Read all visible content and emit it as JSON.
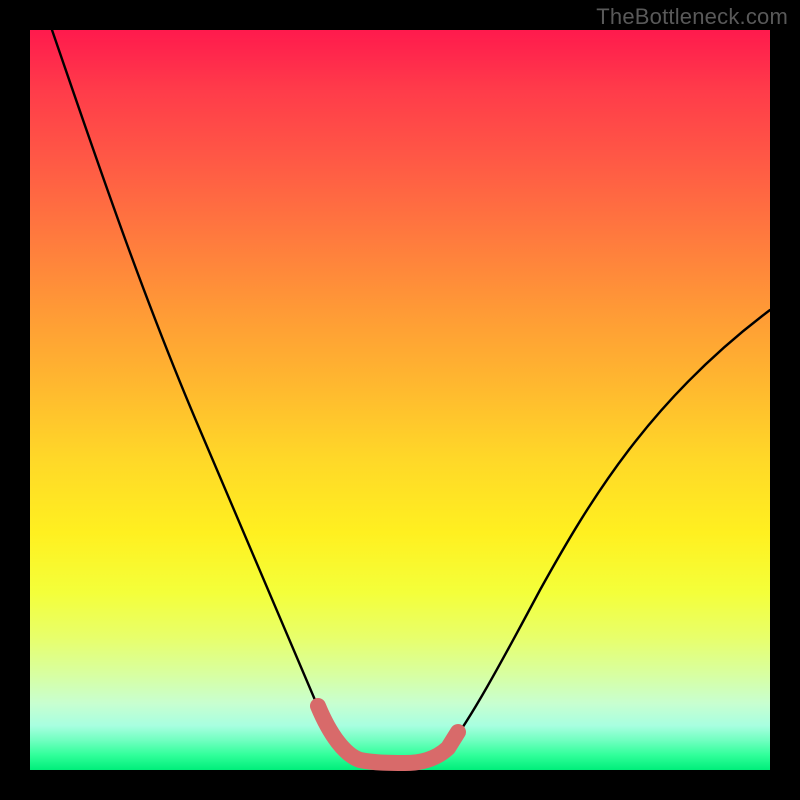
{
  "watermark": "TheBottleneck.com",
  "chart_data": {
    "type": "line",
    "title": "",
    "xlabel": "",
    "ylabel": "",
    "xlim": [
      0,
      100
    ],
    "ylim": [
      0,
      100
    ],
    "grid": false,
    "legend": false,
    "series": [
      {
        "name": "bottleneck-curve",
        "color": "#000000",
        "x": [
          3,
          10,
          18,
          25,
          30,
          35,
          38,
          40,
          42,
          44,
          46,
          50,
          54,
          56,
          58,
          62,
          68,
          75,
          82,
          90,
          100
        ],
        "y": [
          100,
          82,
          62,
          44,
          32,
          20,
          12,
          8,
          5,
          3,
          2,
          2,
          2,
          3,
          5,
          10,
          20,
          32,
          42,
          52,
          62
        ]
      },
      {
        "name": "highlight-band",
        "color": "#d86a6a",
        "x": [
          40,
          42,
          44,
          46,
          50,
          54,
          56,
          58
        ],
        "y": [
          8,
          5,
          3,
          2,
          2,
          2,
          3,
          5
        ]
      }
    ],
    "background_gradient": {
      "top": "#ff1a4d",
      "mid": "#ffe028",
      "bottom": "#00ee7a"
    }
  }
}
